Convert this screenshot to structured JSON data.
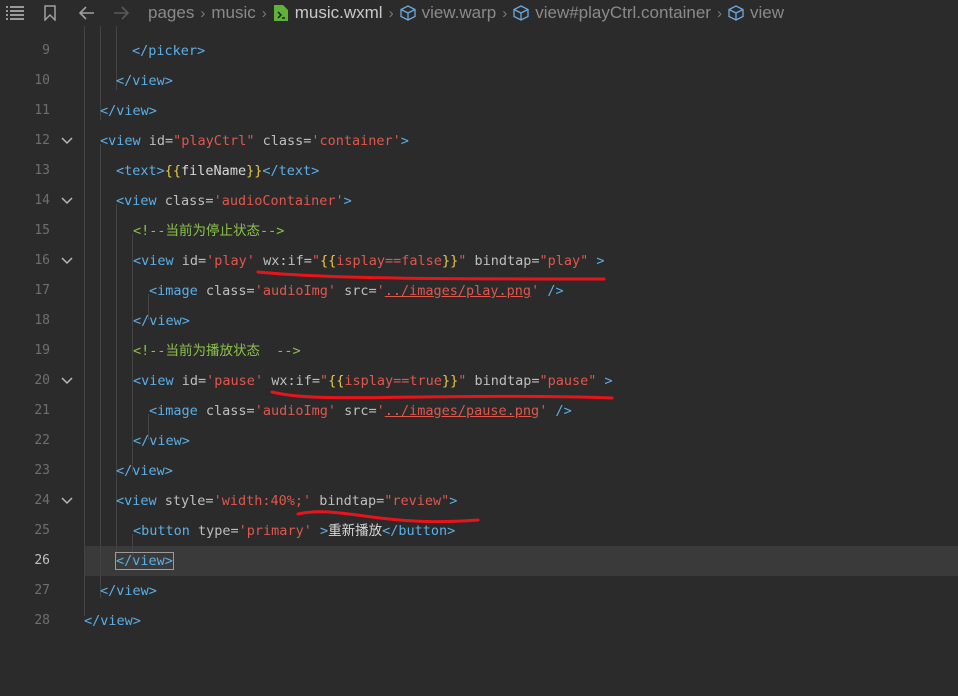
{
  "toolbar": {
    "menu_icon": "list-icon",
    "bookmark_icon": "bookmark-icon",
    "back_icon": "arrow-left-icon",
    "forward_icon": "arrow-right-icon",
    "breadcrumb": {
      "pages": "pages",
      "music": "music",
      "file": "music.wxml",
      "warp": "view.warp",
      "container": "view#playCtrl.container",
      "view": "view"
    }
  },
  "editor": {
    "lines": [
      {
        "n": "9",
        "parts": [
          {
            "text": "</",
            "c": "t"
          },
          {
            "text": "picker",
            "c": "t"
          },
          {
            "text": ">",
            "c": "t"
          }
        ]
      },
      {
        "n": "10",
        "parts": [
          {
            "text": "</view>",
            "c": "t"
          }
        ]
      },
      {
        "n": "11",
        "parts": [
          {
            "text": "</view>",
            "c": "t"
          }
        ]
      },
      {
        "n": "12",
        "parts": [
          {
            "text": "<view ",
            "c": "t"
          },
          {
            "text": "id=",
            "c": "a"
          },
          {
            "text": "\"playCtrl\"",
            "c": "s"
          },
          {
            "text": " class=",
            "c": "a"
          },
          {
            "text": "'container'",
            "c": "s"
          },
          {
            "text": ">",
            "c": "t"
          }
        ]
      },
      {
        "n": "13",
        "parts": [
          {
            "text": "<text>",
            "c": "t"
          },
          {
            "text": "{{",
            "c": "b"
          },
          {
            "text": "fileName",
            "c": "tx"
          },
          {
            "text": "}}",
            "c": "b"
          },
          {
            "text": "</text>",
            "c": "t"
          }
        ]
      },
      {
        "n": "14",
        "parts": [
          {
            "text": "<view ",
            "c": "t"
          },
          {
            "text": "class=",
            "c": "a"
          },
          {
            "text": "'audioContainer'",
            "c": "s"
          },
          {
            "text": ">",
            "c": "t"
          }
        ]
      },
      {
        "n": "15",
        "parts": [
          {
            "text": "<!--当前为停止状态-->",
            "c": "c"
          }
        ]
      },
      {
        "n": "16",
        "parts": [
          {
            "text": "<view ",
            "c": "t"
          },
          {
            "text": "id=",
            "c": "a"
          },
          {
            "text": "'play'",
            "c": "s"
          },
          {
            "text": " wx:if=",
            "c": "a"
          },
          {
            "text": "\"",
            "c": "s"
          },
          {
            "text": "{{",
            "c": "b"
          },
          {
            "text": "isplay==false",
            "c": "s"
          },
          {
            "text": "}}",
            "c": "b"
          },
          {
            "text": "\"",
            "c": "s"
          },
          {
            "text": " bindtap=",
            "c": "a"
          },
          {
            "text": "\"play\"",
            "c": "s"
          },
          {
            "text": " >",
            "c": "t"
          }
        ]
      },
      {
        "n": "17",
        "parts": [
          {
            "text": "<image ",
            "c": "t"
          },
          {
            "text": "class=",
            "c": "a"
          },
          {
            "text": "'audioImg'",
            "c": "s"
          },
          {
            "text": " src=",
            "c": "a"
          },
          {
            "text": "'",
            "c": "s"
          },
          {
            "text": "../images/play.png",
            "c": "s u"
          },
          {
            "text": "'",
            "c": "s"
          },
          {
            "text": " />",
            "c": "t"
          }
        ]
      },
      {
        "n": "18",
        "parts": [
          {
            "text": "</view>",
            "c": "t"
          }
        ]
      },
      {
        "n": "19",
        "parts": [
          {
            "text": "<!--当前为播放状态  -->",
            "c": "c"
          }
        ]
      },
      {
        "n": "20",
        "parts": [
          {
            "text": "<view ",
            "c": "t"
          },
          {
            "text": "id=",
            "c": "a"
          },
          {
            "text": "'pause'",
            "c": "s"
          },
          {
            "text": " wx:if=",
            "c": "a"
          },
          {
            "text": "\"",
            "c": "s"
          },
          {
            "text": "{{",
            "c": "b"
          },
          {
            "text": "isplay==true",
            "c": "s"
          },
          {
            "text": "}}",
            "c": "b"
          },
          {
            "text": "\"",
            "c": "s"
          },
          {
            "text": " bindtap=",
            "c": "a"
          },
          {
            "text": "\"pause\"",
            "c": "s"
          },
          {
            "text": " >",
            "c": "t"
          }
        ]
      },
      {
        "n": "21",
        "parts": [
          {
            "text": "<image ",
            "c": "t"
          },
          {
            "text": "class=",
            "c": "a"
          },
          {
            "text": "'audioImg'",
            "c": "s"
          },
          {
            "text": " src=",
            "c": "a"
          },
          {
            "text": "'",
            "c": "s"
          },
          {
            "text": "../images/pause.png",
            "c": "s u"
          },
          {
            "text": "'",
            "c": "s"
          },
          {
            "text": " />",
            "c": "t"
          }
        ]
      },
      {
        "n": "22",
        "parts": [
          {
            "text": "</view>",
            "c": "t"
          }
        ]
      },
      {
        "n": "23",
        "parts": [
          {
            "text": "</view>",
            "c": "t"
          }
        ]
      },
      {
        "n": "24",
        "parts": [
          {
            "text": "<view ",
            "c": "t"
          },
          {
            "text": "style=",
            "c": "a"
          },
          {
            "text": "'width:40%;'",
            "c": "s"
          },
          {
            "text": " bindtap=",
            "c": "a"
          },
          {
            "text": "\"review\"",
            "c": "s"
          },
          {
            "text": ">",
            "c": "t"
          }
        ]
      },
      {
        "n": "25",
        "parts": [
          {
            "text": "<button ",
            "c": "t"
          },
          {
            "text": "type=",
            "c": "a"
          },
          {
            "text": "'primary'",
            "c": "s"
          },
          {
            "text": " >",
            "c": "t"
          },
          {
            "text": "重新播放",
            "c": "tx"
          },
          {
            "text": "</button>",
            "c": "t"
          }
        ]
      },
      {
        "n": "26",
        "parts": [
          {
            "text": "</view>",
            "c": "t box"
          }
        ]
      },
      {
        "n": "27",
        "parts": [
          {
            "text": "</view>",
            "c": "t"
          }
        ]
      },
      {
        "n": "28",
        "parts": [
          {
            "text": "</view>",
            "c": "t"
          }
        ]
      }
    ]
  },
  "colors": {
    "background": "#2b2b2b",
    "tag": "#5bb0e8",
    "string": "#e0574e",
    "comment": "#8cc04c",
    "brace": "#e6c84a",
    "annotation": "#e8141c"
  }
}
